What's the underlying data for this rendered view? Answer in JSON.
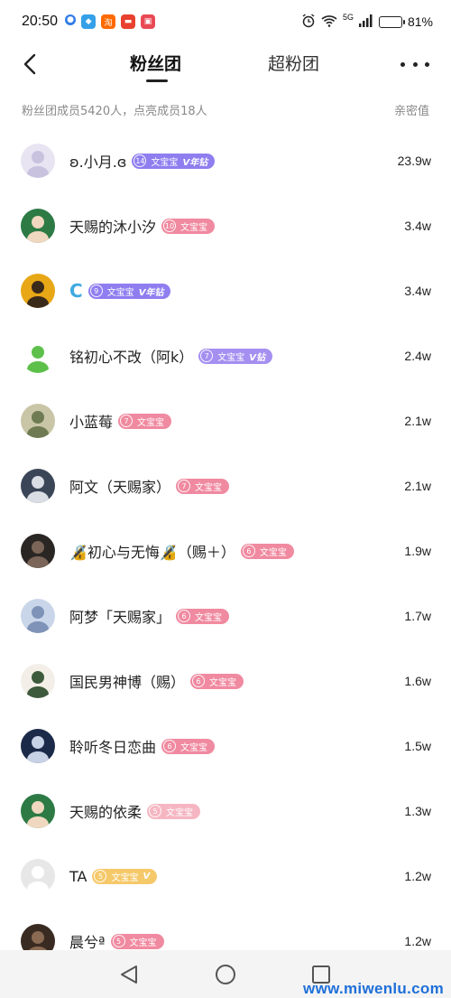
{
  "status_bar": {
    "time": "20:50",
    "app_icons": [
      {
        "name": "notify-dot-icon",
        "color": "#2f7be6",
        "glyph": "●"
      },
      {
        "name": "browser-icon",
        "color": "#35a0e8",
        "glyph": "◆"
      },
      {
        "name": "taobao-icon",
        "color": "#ff6a00",
        "glyph": "淘"
      },
      {
        "name": "shop-icon",
        "color": "#e8412f",
        "glyph": "▬"
      },
      {
        "name": "reader-icon",
        "color": "#e84a55",
        "glyph": "▣"
      }
    ],
    "network": "5G",
    "battery": "81%",
    "battery_level": 0.81
  },
  "nav": {
    "tab_fans": "粉丝团",
    "tab_super": "超粉团"
  },
  "info": {
    "summary": "粉丝团成员5420人，点亮成员18人",
    "value_header": "亲密值"
  },
  "members": [
    {
      "name": "ʚ.小月.ɞ",
      "level": "14",
      "badge_text": "文宝宝",
      "badge_suffix": "V年钻",
      "badge_color": "#8f7ef0",
      "value": "23.9w",
      "avatar_bg": "#e8e4f2",
      "avatar_fg": "#c9c2df"
    },
    {
      "name": "天赐的沐小汐",
      "level": "10",
      "badge_text": "文宝宝",
      "badge_suffix": "",
      "badge_color": "#f08aa0",
      "value": "3.4w",
      "avatar_bg": "#2d7a45",
      "avatar_fg": "#f0d8c0"
    },
    {
      "name": "C",
      "level": "9",
      "badge_text": "文宝宝",
      "badge_suffix": "V年钻",
      "badge_color": "#8f7ef0",
      "value": "3.4w",
      "avatar_bg": "#e8a716",
      "avatar_fg": "#3a2a1a",
      "name_color": "#3fa9e0"
    },
    {
      "name": "铭初心不改（阿k）",
      "level": "7",
      "badge_text": "文宝宝",
      "badge_suffix": "V钻",
      "badge_color": "#a58ff0",
      "value": "2.4w",
      "avatar_bg": "#ffffff",
      "avatar_fg": "#5dc04a"
    },
    {
      "name": "小蓝莓",
      "level": "7",
      "badge_text": "文宝宝",
      "badge_suffix": "",
      "badge_color": "#f08aa0",
      "value": "2.1w",
      "avatar_bg": "#c9c6a8",
      "avatar_fg": "#6f7b52"
    },
    {
      "name": "阿文（天赐家）",
      "level": "7",
      "badge_text": "文宝宝",
      "badge_suffix": "",
      "badge_color": "#f08aa0",
      "value": "2.1w",
      "avatar_bg": "#3a4658",
      "avatar_fg": "#d9dde4"
    },
    {
      "name": "🔏初心与无悔🔏（赐＋）",
      "level": "6",
      "badge_text": "文宝宝",
      "badge_suffix": "",
      "badge_color": "#f08aa0",
      "value": "1.9w",
      "avatar_bg": "#2a2624",
      "avatar_fg": "#7a6558"
    },
    {
      "name": "阿梦「天赐家」",
      "level": "6",
      "badge_text": "文宝宝",
      "badge_suffix": "",
      "badge_color": "#f08aa0",
      "value": "1.7w",
      "avatar_bg": "#c9d6ea",
      "avatar_fg": "#7f93b8"
    },
    {
      "name": "国民男神博（赐）",
      "level": "6",
      "badge_text": "文宝宝",
      "badge_suffix": "",
      "badge_color": "#f08aa0",
      "value": "1.6w",
      "avatar_bg": "#f3efe8",
      "avatar_fg": "#3d5a3c"
    },
    {
      "name": "聆听冬日恋曲",
      "level": "6",
      "badge_text": "文宝宝",
      "badge_suffix": "",
      "badge_color": "#f08aa0",
      "value": "1.5w",
      "avatar_bg": "#1c2a4a",
      "avatar_fg": "#c8d2e6"
    },
    {
      "name": "天赐的依柔",
      "level": "5",
      "badge_text": "文宝宝",
      "badge_suffix": "",
      "badge_color": "#f5b6c2",
      "value": "1.3w",
      "avatar_bg": "#2d7a45",
      "avatar_fg": "#f0d8c0"
    },
    {
      "name": "TA",
      "level": "5",
      "badge_text": "文宝宝",
      "badge_suffix": "V",
      "badge_color": "#f5c96a",
      "value": "1.2w",
      "avatar_bg": "#e7e7e7",
      "avatar_fg": "#ffffff"
    },
    {
      "name": "晨兮ª",
      "level": "5",
      "badge_text": "文宝宝",
      "badge_suffix": "",
      "badge_color": "#f08aa0",
      "value": "1.2w",
      "avatar_bg": "#3a2b22",
      "avatar_fg": "#8a6a52"
    }
  ],
  "watermark": "www.miwenlu.com",
  "icons": {
    "back": "chevron-left-icon",
    "more": "more-dots-icon",
    "nav_back": "triangle-back-icon",
    "nav_home": "circle-home-icon",
    "nav_recent": "square-recent-icon"
  }
}
